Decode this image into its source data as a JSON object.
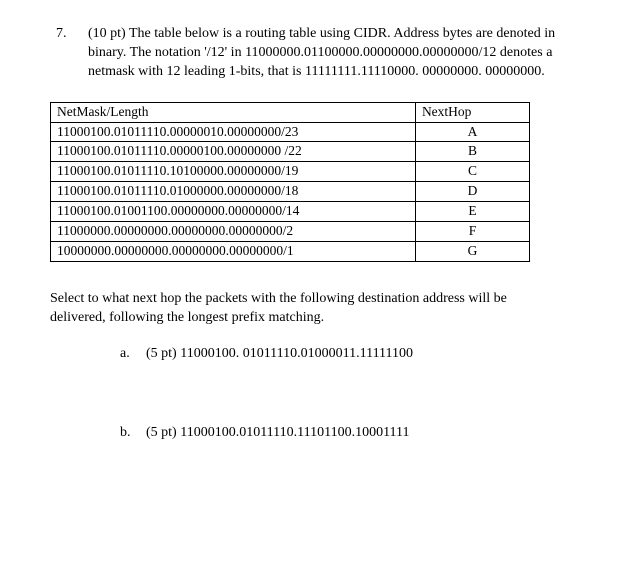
{
  "question": {
    "number": "7.",
    "intro": "(10 pt)   The table below is a routing table using CIDR. Address bytes are denoted in binary. The notation '/12' in 11000000.01100000.00000000.00000000/12 denotes a netmask with 12 leading 1-bits, that is 11111111.11110000. 00000000. 00000000."
  },
  "table": {
    "header_netmask": "NetMask/Length",
    "header_hop": "NextHop",
    "rows": [
      {
        "netmask": "11000100.01011110.00000010.00000000/23",
        "hop": "A"
      },
      {
        "netmask": "11000100.01011110.00000100.00000000 /22",
        "hop": "B"
      },
      {
        "netmask": "11000100.01011110.10100000.00000000/19",
        "hop": "C"
      },
      {
        "netmask": "11000100.01011110.01000000.00000000/18",
        "hop": "D"
      },
      {
        "netmask": "11000100.01001100.00000000.00000000/14",
        "hop": "E"
      },
      {
        "netmask": "11000000.00000000.00000000.00000000/2",
        "hop": "F"
      },
      {
        "netmask": "10000000.00000000.00000000.00000000/1",
        "hop": "G"
      }
    ]
  },
  "instruction": "Select to what next hop the packets with the following destination address will be delivered, following the longest prefix matching.",
  "sub": {
    "a": {
      "label": "a.",
      "text": "(5 pt) 11000100. 01011110.01000011.11111100"
    },
    "b": {
      "label": "b.",
      "text": "(5 pt) 11000100.01011110.11101100.10001111"
    }
  }
}
